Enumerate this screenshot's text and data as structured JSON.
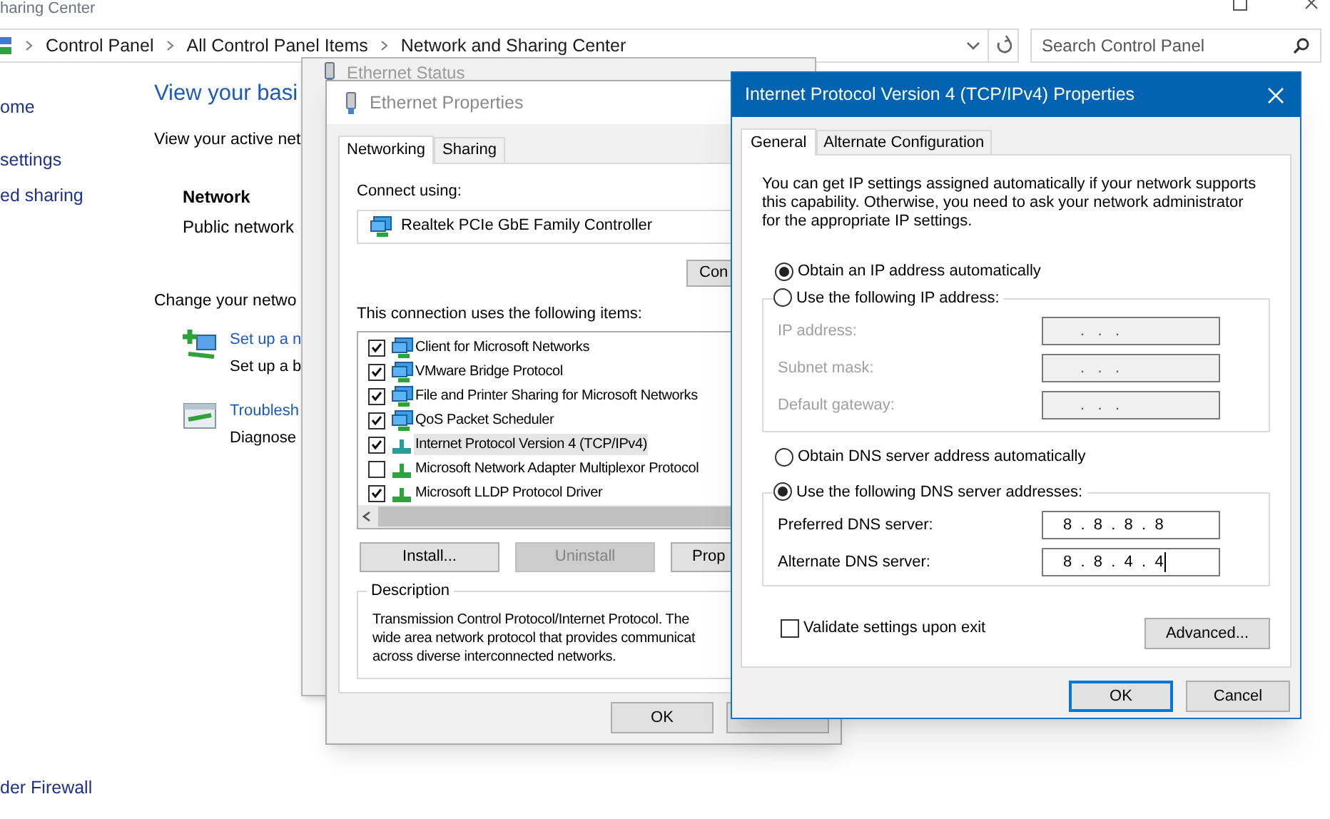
{
  "explorer": {
    "title": "haring Center",
    "breadcrumbs": [
      "Control Panel",
      "All Control Panel Items",
      "Network and Sharing Center"
    ],
    "search": {
      "placeholder": "Search Control Panel"
    },
    "sidebar": {
      "items": [
        "ome",
        "settings",
        "ed sharing"
      ],
      "footer": "der Firewall"
    },
    "heading": "View your basi",
    "active_networks_label": "View your active net",
    "network": {
      "name": "Network",
      "type": "Public network"
    },
    "change_heading": "Change your netwo",
    "tasks": [
      {
        "kind": "setup",
        "link": "Set up a n",
        "description": "Set up a b"
      },
      {
        "kind": "troubleshoot",
        "link": "Troublesh",
        "description": "Diagnose"
      }
    ]
  },
  "status_window": {
    "title": "Ethernet Status"
  },
  "properties_window": {
    "title": "Ethernet Properties",
    "tabs": [
      {
        "label": "Networking",
        "selected": true
      },
      {
        "label": "Sharing",
        "selected": false
      }
    ],
    "connect_using_label": "Connect using:",
    "adapter": "Realtek PCIe GbE Family Controller",
    "configure_button": "Con",
    "items_label": "This connection uses the following items:",
    "items": [
      {
        "kind": "client",
        "label": "Client for Microsoft Networks",
        "checked": true,
        "selected": false
      },
      {
        "kind": "client",
        "label": "VMware Bridge Protocol",
        "checked": true,
        "selected": false
      },
      {
        "kind": "client",
        "label": "File and Printer Sharing for Microsoft Networks",
        "checked": true,
        "selected": false
      },
      {
        "kind": "client",
        "label": "QoS Packet Scheduler",
        "checked": true,
        "selected": false
      },
      {
        "kind": "protocol",
        "label": "Internet Protocol Version 4 (TCP/IPv4)",
        "checked": true,
        "selected": true
      },
      {
        "kind": "protocol",
        "label": "Microsoft Network Adapter Multiplexor Protocol",
        "checked": false,
        "selected": false
      },
      {
        "kind": "protocol",
        "label": "Microsoft LLDP Protocol Driver",
        "checked": true,
        "selected": false
      }
    ],
    "buttons": [
      {
        "label": "Install...",
        "disabled": false
      },
      {
        "label": "Uninstall",
        "disabled": true
      },
      {
        "label": "Prop",
        "disabled": false
      }
    ],
    "description": {
      "title": "Description",
      "lines": [
        "Transmission Control Protocol/Internet Protocol. The",
        "wide area network protocol that provides communicat",
        "across diverse interconnected networks."
      ]
    },
    "ok_button": "OK"
  },
  "ipv4_window": {
    "title": "Internet Protocol Version 4 (TCP/IPv4) Properties",
    "tabs": [
      {
        "label": "General",
        "selected": true
      },
      {
        "label": "Alternate Configuration",
        "selected": false
      }
    ],
    "intro": "You can get IP settings assigned automatically if your network supports this capability. Otherwise, you need to ask your network administrator for the appropriate IP settings.",
    "ip_mode": [
      {
        "label": "Obtain an IP address automatically",
        "selected": true
      },
      {
        "label": "Use the following IP address:",
        "selected": false
      }
    ],
    "ip_fields": [
      {
        "label": "IP address:",
        "value": ".   .   .",
        "disabled": true,
        "focused": false
      },
      {
        "label": "Subnet mask:",
        "value": ".   .   .",
        "disabled": true,
        "focused": false
      },
      {
        "label": "Default gateway:",
        "value": ".   .   .",
        "disabled": true,
        "focused": false
      }
    ],
    "dns_mode": [
      {
        "label": "Obtain DNS server address automatically",
        "selected": false
      },
      {
        "label": "Use the following DNS server addresses:",
        "selected": true
      }
    ],
    "dns_fields": [
      {
        "label": "Preferred DNS server:",
        "value": "8  .  8  .  8  .  8",
        "disabled": false,
        "focused": false
      },
      {
        "label": "Alternate DNS server:",
        "value": "8  .  8  .  4  .  4",
        "disabled": false,
        "focused": true
      }
    ],
    "validate": {
      "label": "Validate settings upon exit",
      "checked": false
    },
    "advanced_button": "Advanced...",
    "ok_button": "OK",
    "cancel_button": "Cancel"
  }
}
